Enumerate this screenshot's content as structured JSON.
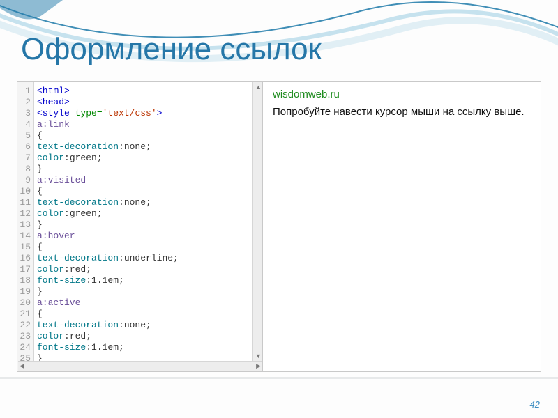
{
  "slide": {
    "title": "Оформление ссылок",
    "page_number": "42"
  },
  "code": {
    "lines": [
      [
        {
          "t": "t-tag",
          "v": "<html>"
        }
      ],
      [
        {
          "t": "t-tag",
          "v": "<head>"
        }
      ],
      [
        {
          "t": "t-tag",
          "v": "<style"
        },
        {
          "t": "",
          "v": " "
        },
        {
          "t": "t-attr",
          "v": "type="
        },
        {
          "t": "t-str",
          "v": "'text/css'"
        },
        {
          "t": "t-tag",
          "v": ">"
        }
      ],
      [
        {
          "t": "t-sel",
          "v": "a:link"
        }
      ],
      [
        {
          "t": "",
          "v": "{"
        }
      ],
      [
        {
          "t": "t-prop",
          "v": "text-decoration"
        },
        {
          "t": "",
          "v": ":none;"
        }
      ],
      [
        {
          "t": "t-prop",
          "v": "color"
        },
        {
          "t": "",
          "v": ":green;"
        }
      ],
      [
        {
          "t": "",
          "v": "}"
        }
      ],
      [
        {
          "t": "t-sel",
          "v": "a:visited"
        }
      ],
      [
        {
          "t": "",
          "v": "{"
        }
      ],
      [
        {
          "t": "t-prop",
          "v": "text-decoration"
        },
        {
          "t": "",
          "v": ":none;"
        }
      ],
      [
        {
          "t": "t-prop",
          "v": "color"
        },
        {
          "t": "",
          "v": ":green;"
        }
      ],
      [
        {
          "t": "",
          "v": "}"
        }
      ],
      [
        {
          "t": "t-sel",
          "v": "a:hover"
        }
      ],
      [
        {
          "t": "",
          "v": "{"
        }
      ],
      [
        {
          "t": "t-prop",
          "v": "text-decoration"
        },
        {
          "t": "",
          "v": ":underline;"
        }
      ],
      [
        {
          "t": "t-prop",
          "v": "color"
        },
        {
          "t": "",
          "v": ":red;"
        }
      ],
      [
        {
          "t": "t-prop",
          "v": "font-size"
        },
        {
          "t": "",
          "v": ":1.1em;"
        }
      ],
      [
        {
          "t": "",
          "v": "}"
        }
      ],
      [
        {
          "t": "t-sel",
          "v": "a:active"
        }
      ],
      [
        {
          "t": "",
          "v": "{"
        }
      ],
      [
        {
          "t": "t-prop",
          "v": "text-decoration"
        },
        {
          "t": "",
          "v": ":none;"
        }
      ],
      [
        {
          "t": "t-prop",
          "v": "color"
        },
        {
          "t": "",
          "v": ":red;"
        }
      ],
      [
        {
          "t": "t-prop",
          "v": "font-size"
        },
        {
          "t": "",
          "v": ":1.1em;"
        }
      ],
      [
        {
          "t": "",
          "v": "}"
        }
      ]
    ]
  },
  "output": {
    "link_text": "wisdomweb.ru",
    "paragraph": "Попробуйте навести курсор мыши на ссылку выше."
  }
}
